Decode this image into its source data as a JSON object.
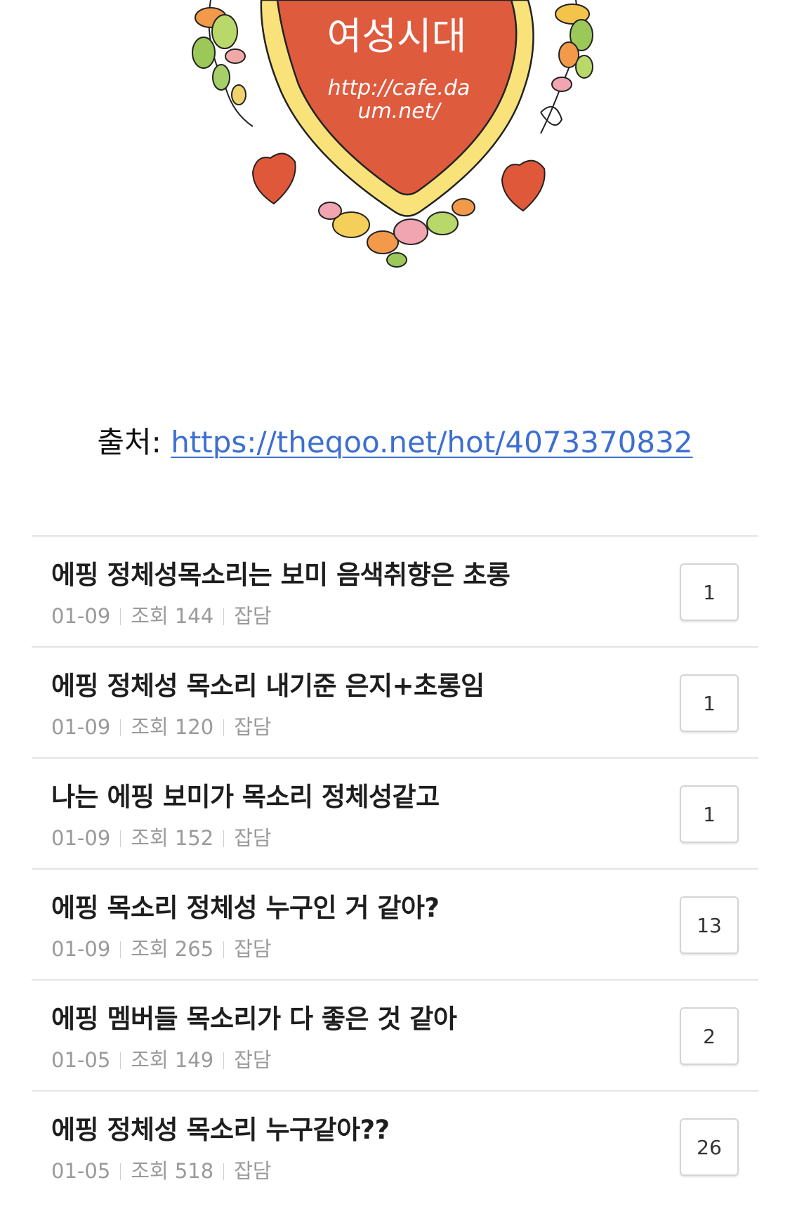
{
  "emblem": {
    "title": "여성시대",
    "url_line1": "http://cafe.da",
    "url_line2": "um.net/"
  },
  "source": {
    "label": "출처:",
    "link": "https://theqoo.net/hot/4073370832"
  },
  "posts": [
    {
      "title": "에핑 정체성목소리는 보미 음색취향은 초롱",
      "date": "01-09",
      "views": "조회 144",
      "category": "잡담",
      "comments": "1"
    },
    {
      "title": "에핑 정체성 목소리 내기준 은지+초롱임",
      "date": "01-09",
      "views": "조회 120",
      "category": "잡담",
      "comments": "1"
    },
    {
      "title": "나는 에핑 보미가 목소리 정체성같고",
      "date": "01-09",
      "views": "조회 152",
      "category": "잡담",
      "comments": "1"
    },
    {
      "title": "에핑 목소리 정체성 누구인 거 같아?",
      "date": "01-09",
      "views": "조회 265",
      "category": "잡담",
      "comments": "13"
    },
    {
      "title": "에핑 멤버들 목소리가 다 좋은 것 같아",
      "date": "01-05",
      "views": "조회 149",
      "category": "잡담",
      "comments": "2"
    },
    {
      "title": "에핑 정체성 목소리 누구같아??",
      "date": "01-05",
      "views": "조회 518",
      "category": "잡담",
      "comments": "26"
    }
  ]
}
